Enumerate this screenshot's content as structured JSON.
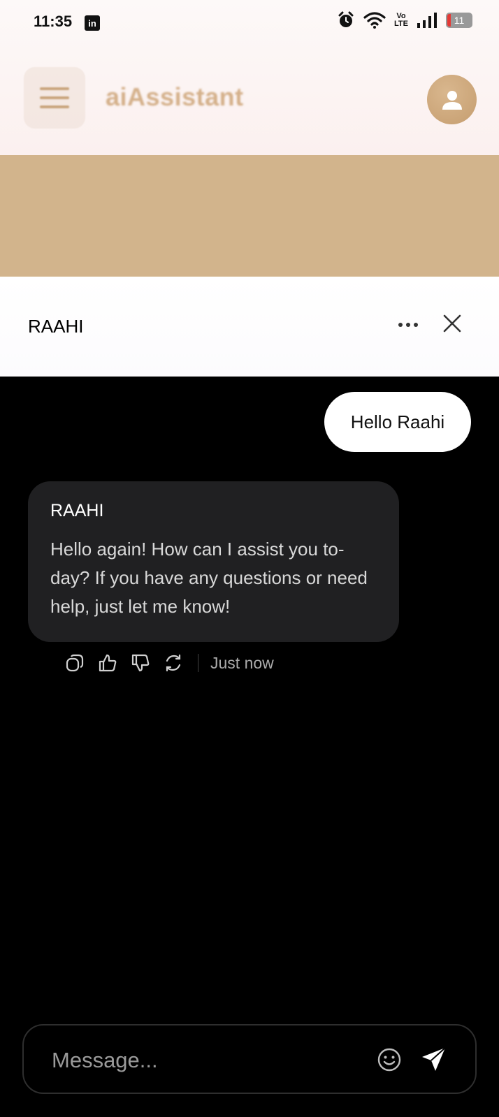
{
  "status_bar": {
    "time": "11:35",
    "notification_app": "in",
    "network_label": "Vo\nLTE",
    "battery": "11",
    "icons": [
      "linkedin-icon",
      "alarm-icon",
      "wifi-icon",
      "signal-icon",
      "battery-icon"
    ]
  },
  "header": {
    "brand": "aiAssistant",
    "accent_color": "#d2b48c"
  },
  "chat": {
    "title": "RAAHI",
    "messages": {
      "user": "Hello Raahi",
      "bot_name": "RAAHI",
      "bot_text": "Hello again! How can I assist you to-day? If you have any questions or need help, just let me know!",
      "timestamp": "Just now"
    },
    "actions": [
      "copy-icon",
      "thumbs-up-icon",
      "thumbs-down-icon",
      "regenerate-icon"
    ]
  },
  "composer": {
    "placeholder": "Message..."
  }
}
